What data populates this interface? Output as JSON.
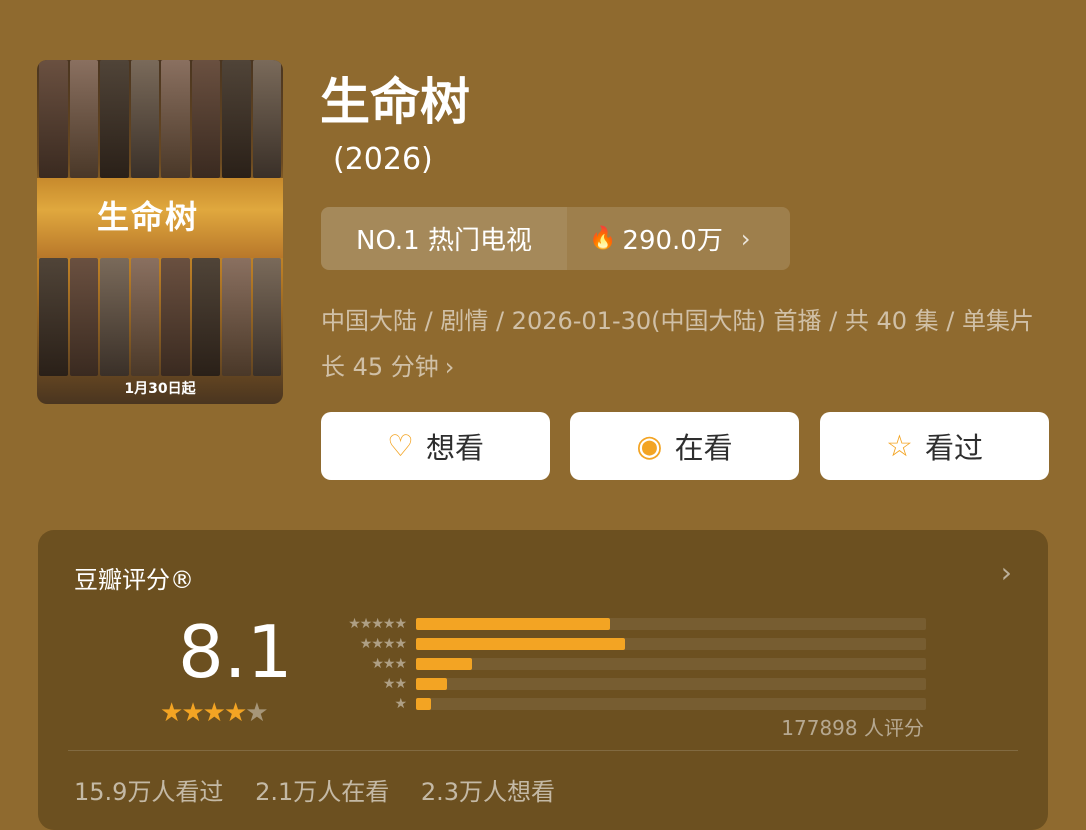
{
  "poster": {
    "title_art": "生命树",
    "date_text": "1月30日起"
  },
  "title": "生命树",
  "year": "(2026)",
  "rank": {
    "label": "NO.1 热门电视",
    "heat": "290.0万",
    "flame_icon": "flame-icon",
    "chevron_icon": "chevron-right-icon"
  },
  "meta": {
    "text": "中国大陆 / 剧情 / 2026-01-30(中国大陆) 首播 / 共 40 集 / 单集片长 45 分钟"
  },
  "actions": [
    {
      "label": "想看",
      "icon": "♡"
    },
    {
      "label": "在看",
      "icon": "◉"
    },
    {
      "label": "看过",
      "icon": "☆"
    }
  ],
  "rating": {
    "label": "豆瓣评分®",
    "score": "8.1",
    "stars_filled": 4,
    "distribution": [
      {
        "stars": "★★★★★",
        "pct": 38
      },
      {
        "stars": "★★★★",
        "pct": 41
      },
      {
        "stars": "★★★",
        "pct": 11
      },
      {
        "stars": "★★",
        "pct": 6
      },
      {
        "stars": "★",
        "pct": 3
      }
    ],
    "count": "177898 人评分"
  },
  "stats": {
    "watched": "15.9万人看过",
    "watching": "2.1万人在看",
    "want": "2.3万人想看"
  },
  "colors": {
    "background": "#8f6a2f",
    "accent": "#f3a423"
  }
}
